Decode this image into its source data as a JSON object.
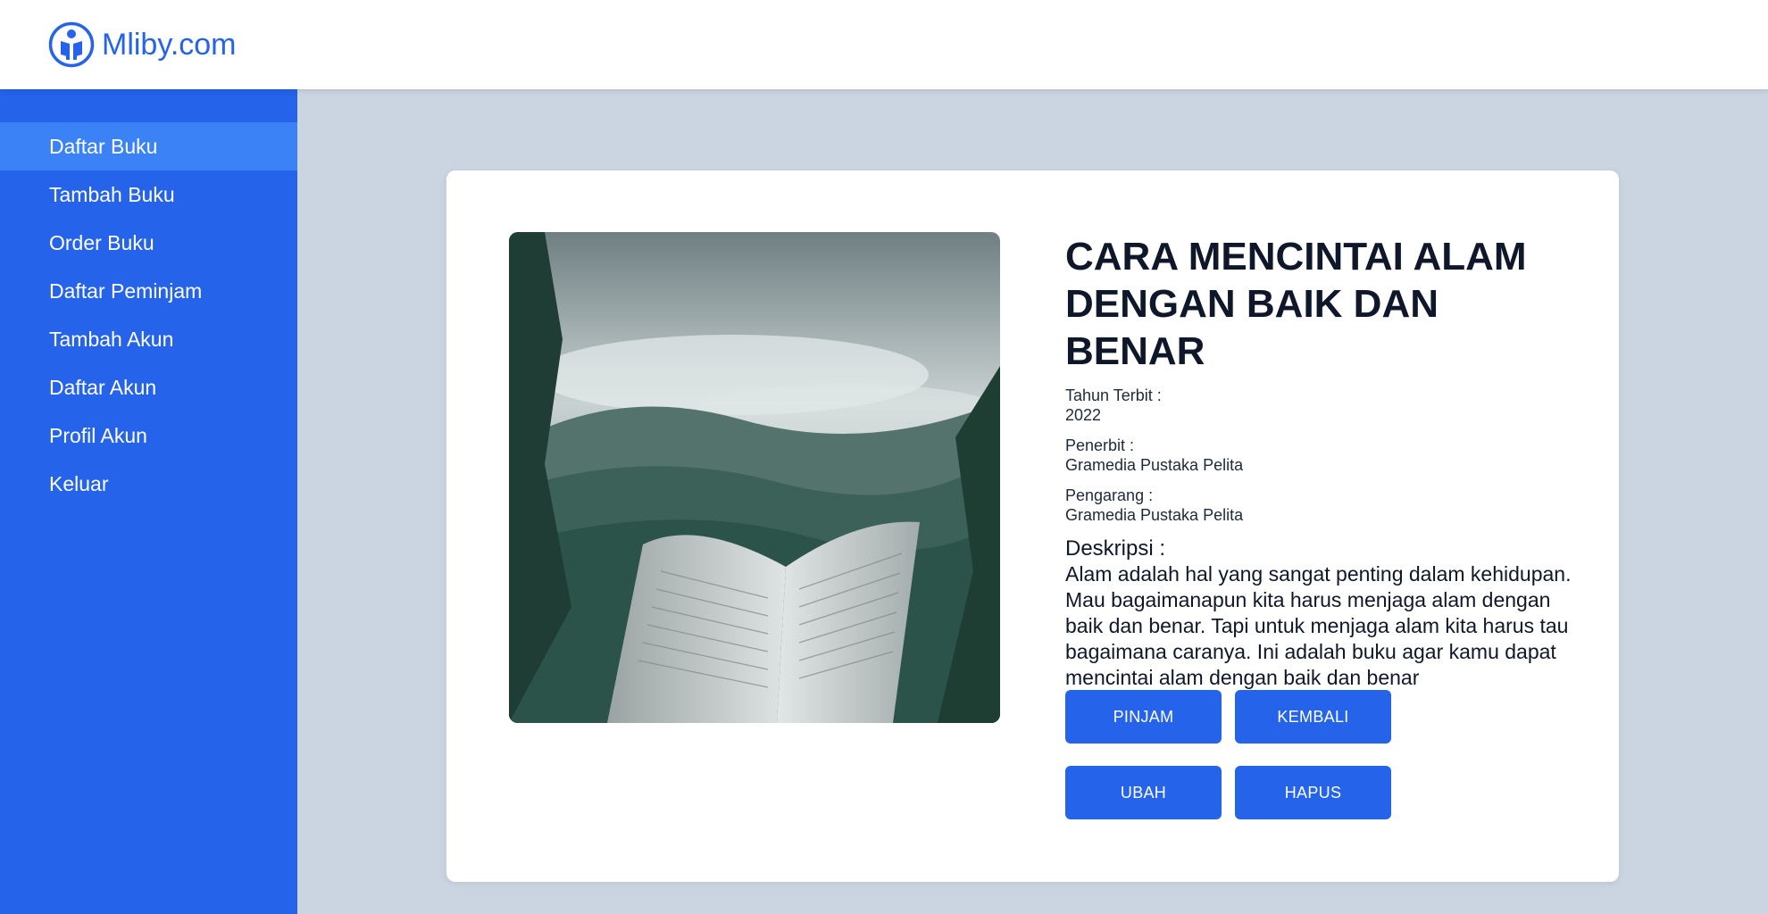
{
  "brand": {
    "name": "Mliby.com",
    "icon": "reader-logo-icon",
    "color": "#2563eb"
  },
  "sidebar": {
    "items": [
      {
        "label": "Daftar Buku",
        "active": true
      },
      {
        "label": "Tambah Buku"
      },
      {
        "label": "Order Buku"
      },
      {
        "label": "Daftar Peminjam"
      },
      {
        "label": "Tambah Akun"
      },
      {
        "label": "Daftar Akun"
      },
      {
        "label": "Profil Akun"
      },
      {
        "label": "Keluar"
      }
    ]
  },
  "book": {
    "title": "CARA MENCINTAI ALAM DENGAN BAIK DAN BENAR",
    "year_label": "Tahun Terbit :",
    "year": "2022",
    "publisher_label": "Penerbit :",
    "publisher": "Gramedia Pustaka Pelita",
    "author_label": "Pengarang :",
    "author": "Gramedia Pustaka Pelita",
    "description_label": "Deskripsi :",
    "description": "Alam adalah hal yang sangat penting dalam kehidupan. Mau bagaimanapun kita harus menjaga alam dengan baik dan benar. Tapi untuk menjaga alam kita harus tau bagaimana caranya. Ini adalah buku agar kamu dapat mencintai alam dengan baik dan benar"
  },
  "actions": {
    "borrow": "PINJAM",
    "return": "KEMBALI",
    "edit": "UBAH",
    "delete": "HAPUS"
  },
  "colors": {
    "primary": "#2563eb",
    "active_nav": "#3b82f6",
    "background": "#cbd5e1"
  }
}
